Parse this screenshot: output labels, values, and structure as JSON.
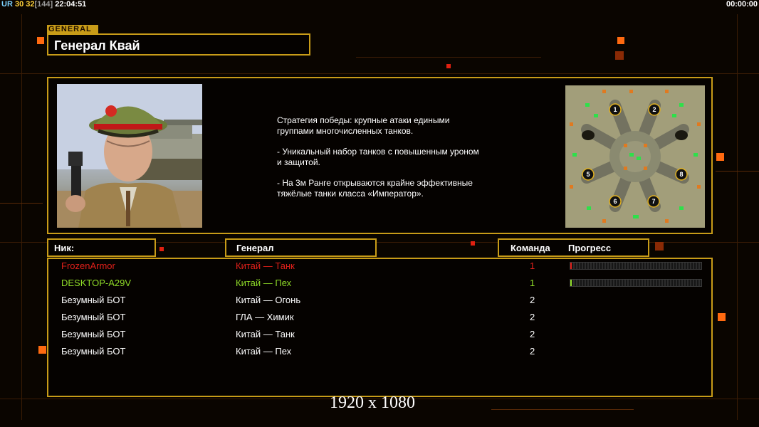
{
  "hud": {
    "ur": "UR",
    "value_a": "30",
    "value_b": "32",
    "bracket_value": "[144]",
    "clock": "22:04:51",
    "timer": "00:00:00"
  },
  "general": {
    "section_tag": "GENERAL",
    "name": "Генерал Квай",
    "strategy": [
      "Стратегия победы: крупные атаки едиными\n группами многочисленных танков.",
      "- Уникальный набор танков с повышенным уроном\n и защитой.",
      "- На 3м Ранге открываются крайне эффективные\n тяжёлые танки класса «Император»."
    ]
  },
  "map": {
    "start_positions": [
      "1",
      "2",
      "5",
      "8",
      "6",
      "7"
    ]
  },
  "table": {
    "headers": {
      "nick": "Ник:",
      "general": "Генерал",
      "team": "Команда",
      "progress": "Прогресс"
    },
    "rows": [
      {
        "nick": "FrozenArmor",
        "general": "Китай — Танк",
        "team": "1",
        "color": "#e0201a",
        "progress": 0.01
      },
      {
        "nick": "DESKTOP-A29V",
        "general": "Китай — Пех",
        "team": "1",
        "color": "#8fdc28",
        "progress": 0.01
      },
      {
        "nick": "Безумный БОТ",
        "general": "Китай — Огонь",
        "team": "2",
        "color": "#ffffff"
      },
      {
        "nick": "Безумный БОТ",
        "general": "ГЛА — Химик",
        "team": "2",
        "color": "#ffffff"
      },
      {
        "nick": "Безумный БОТ",
        "general": "Китай — Танк",
        "team": "2",
        "color": "#ffffff"
      },
      {
        "nick": "Безумный БОТ",
        "general": "Китай — Пех",
        "team": "2",
        "color": "#ffffff"
      }
    ]
  },
  "resolution": "1920 x 1080",
  "colors": {
    "frame": "#c89c18",
    "accent": "#ff6a10"
  }
}
